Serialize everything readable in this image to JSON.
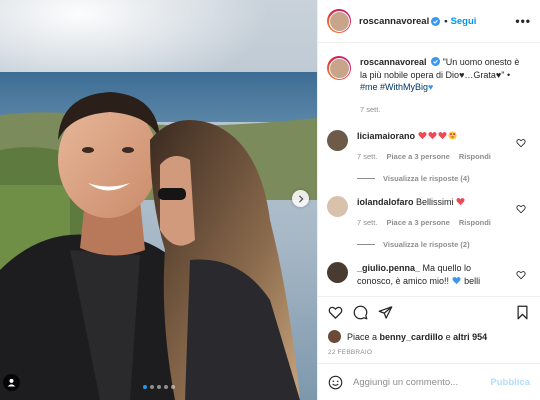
{
  "post": {
    "author": "roscannavoreal",
    "follow_label": "Segui",
    "more_label": "•••",
    "caption": {
      "username": "roscannavoreal",
      "text": "\"Un uomo onesto è la più nobile opera di Dio♥…Grata♥\"",
      "bullet": "•",
      "hashtags": "#me #WithMyBig",
      "tail_heart": "♥",
      "time": "7 sett."
    },
    "comments": [
      {
        "username": "liciamaiorano",
        "text": "",
        "emojis": [
          "heart-red",
          "heart-red",
          "heart-red",
          "heart-eyes"
        ],
        "time": "7 sett.",
        "likes": "Piace a 3 persone",
        "reply": "Rispondi",
        "replies_label": "Visualizza le risposte (4)"
      },
      {
        "username": "iolandalofaro",
        "text": "Bellissimi",
        "emojis": [
          "heart-red"
        ],
        "time": "7 sett.",
        "likes": "Piace a 3 persone",
        "reply": "Rispondi",
        "replies_label": "Visualizza le risposte (2)"
      },
      {
        "username": "_giulio.penna_",
        "text": "Ma quello lo conosco, è amico mio!! ",
        "tail": "belli",
        "emojis": [
          "heart-blue"
        ]
      }
    ],
    "likes_prefix": "Piace a",
    "liked_by": "benny_cardillo",
    "likes_suffix": "e",
    "likes_others": "altri 954",
    "date": "22 FEBBRAIO",
    "comment_placeholder": "Aggiungi un commento...",
    "publish_label": "Pubblica",
    "carousel": {
      "count": 5,
      "active_index": 0
    }
  },
  "colors": {
    "accent_blue": "#0095f6",
    "muted_gray": "#8e8e8e",
    "heart_red": "#ed4956",
    "publish_disabled": "#b2dffc"
  },
  "icons": [
    "verified-icon",
    "chevron-right-icon",
    "user-tag-icon",
    "heart-icon",
    "comment-icon",
    "share-icon",
    "bookmark-icon",
    "emoji-icon"
  ]
}
